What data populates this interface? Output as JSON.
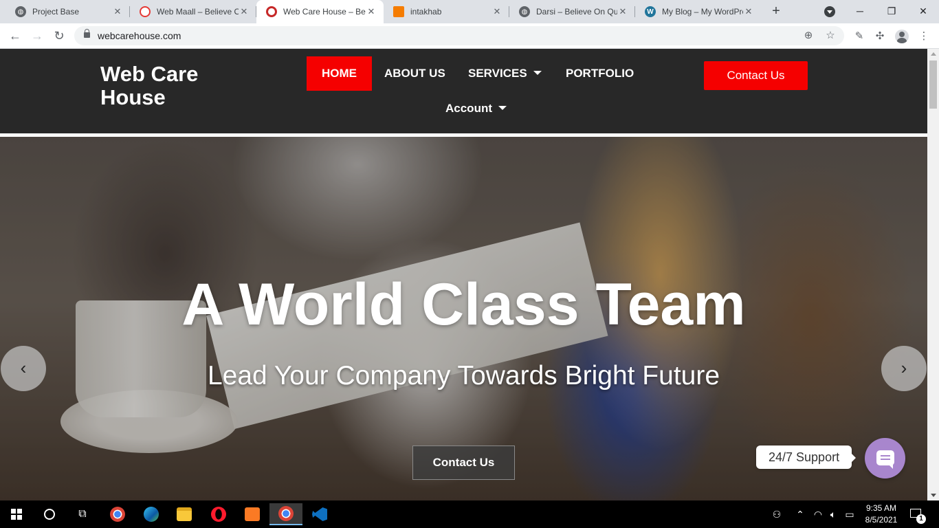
{
  "browser": {
    "tabs": [
      {
        "title": "Project Base",
        "favicon": "globe-icon",
        "color": "#5f6368"
      },
      {
        "title": "Web Maall – Believe On Quality",
        "favicon": "web-maall-icon",
        "color": "#e53935"
      },
      {
        "title": "Web Care House – Believe On Quality",
        "favicon": "web-care-house-icon",
        "color": "#c62828"
      },
      {
        "title": "intakhab",
        "favicon": "orange-square-icon",
        "color": "#f57c00"
      },
      {
        "title": "Darsi – Believe On Quality",
        "favicon": "globe-icon",
        "color": "#5f6368"
      },
      {
        "title": "My Blog – My WordPress Blog",
        "favicon": "wordpress-icon",
        "color": "#21759b"
      }
    ],
    "active_tab_index": 2,
    "url": "webcarehouse.com",
    "new_tab_symbol": "+",
    "close_symbol": "✕"
  },
  "site": {
    "logo": "Web Care House",
    "nav": {
      "home": "HOME",
      "about": "ABOUT US",
      "services": "SERVICES",
      "portfolio": "PORTFOLIO",
      "account": "Account"
    },
    "header_cta": "Contact Us",
    "accent_color": "#f50000"
  },
  "hero": {
    "title": "A World Class Team",
    "subtitle": "Lead Your Company Towards Bright Future",
    "button": "Contact Us",
    "prev_symbol": "‹",
    "next_symbol": "›"
  },
  "support": {
    "label": "24/7 Support",
    "button_color": "#a886cd"
  },
  "taskbar": {
    "time": "9:35 AM",
    "date": "8/5/2021",
    "notification_count": "1",
    "apps": [
      "chrome-icon",
      "edge-icon",
      "file-explorer-icon",
      "opera-icon",
      "xampp-icon",
      "chrome-icon",
      "vscode-icon"
    ]
  }
}
